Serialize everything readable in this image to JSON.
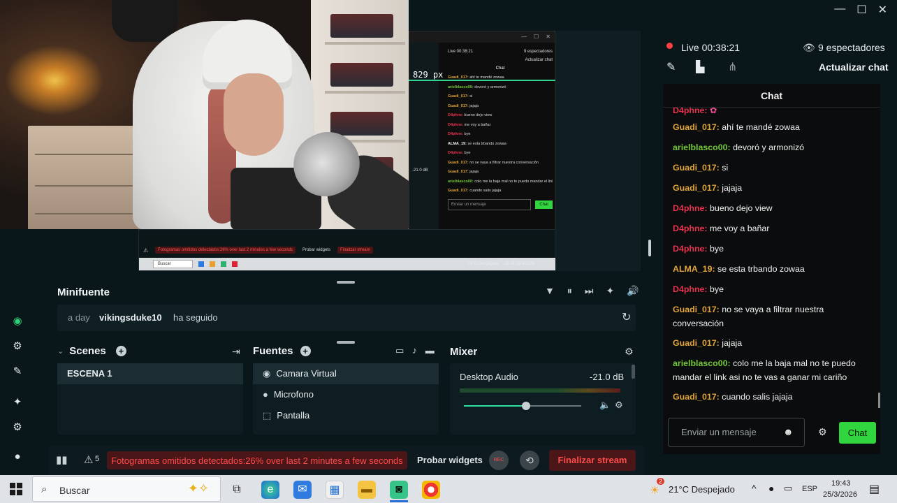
{
  "window": {
    "min": "—",
    "max": "☐",
    "close": "✕",
    "collapse": "›"
  },
  "preview": {
    "pixel_label": "829 px",
    "title_controls": [
      "—",
      "☐",
      "✕"
    ],
    "live": "Live 00:38:21",
    "viewers": "9 espectadores",
    "update": "Actualizar chat",
    "chat_heading": "Chat",
    "messages": [
      {
        "user": "Guadi_017:",
        "text": "ahí te mandé zowaa",
        "color": "#e0a43a"
      },
      {
        "user": "arielblasco00:",
        "text": "devoró y armonizó",
        "color": "#74c93a"
      },
      {
        "user": "Guadi_017:",
        "text": "si",
        "color": "#e0a43a"
      },
      {
        "user": "Guadi_017:",
        "text": "jajaja",
        "color": "#e0a43a"
      },
      {
        "user": "D4phne:",
        "text": "bueno dejo view",
        "color": "#e8334f"
      },
      {
        "user": "D4phne:",
        "text": "me voy a bañar",
        "color": "#e8334f"
      },
      {
        "user": "D4phne:",
        "text": "bye",
        "color": "#e8334f"
      },
      {
        "user": "ALMA_19:",
        "text": "se esta trbando zowaa",
        "color": "#f0f0f0"
      },
      {
        "user": "D4phne:",
        "text": "bye",
        "color": "#e8334f"
      },
      {
        "user": "Guadi_017:",
        "text": "no se vaya a filtrar nuestra conversación",
        "color": "#e0a43a"
      },
      {
        "user": "Guadi_017:",
        "text": "jajaja",
        "color": "#e0a43a"
      },
      {
        "user": "arielblasco00:",
        "text": "colo me la baja mal no te puedo mandar el link asi no te vas a ganar mi cariño",
        "color": "#74c93a"
      },
      {
        "user": "Guadi_017:",
        "text": "cuando salis jajaja",
        "color": "#e0a43a"
      }
    ],
    "input_placeholder": "Enviar un mensaje",
    "chat_button": "Chat",
    "db": "-21.0 dB",
    "temp": "21°C Despejado",
    "time": "19:43",
    "date": "25/3/2026",
    "search": "Buscar",
    "dropped": "Fotogramas omitidos detectados:26% over last 2 minutes a few seconds",
    "probar": "Probar widgets",
    "finalizar": "Finalizar stream"
  },
  "minifuente": {
    "title": "Minifuente",
    "event_time": "a day",
    "event_user": "vikingsduke10",
    "event_action": "ha seguido",
    "controls": [
      "▼",
      "⏸",
      "⏭",
      "✦",
      "🔊"
    ]
  },
  "scenes": {
    "title": "Scenes",
    "items": [
      "ESCENA 1"
    ]
  },
  "sources": {
    "title": "Fuentes",
    "items": [
      {
        "label": "Camara Virtual",
        "icon": "webcam-icon"
      },
      {
        "label": "Microfono",
        "icon": "microphone-icon"
      },
      {
        "label": "Pantalla",
        "icon": "screen-icon"
      }
    ]
  },
  "mixer": {
    "title": "Mixer",
    "channel": "Desktop Audio",
    "db": "-21.0 dB",
    "volume_fraction": 0.53
  },
  "footer": {
    "alerts": "5",
    "dropped": "Fotogramas omitidos detectados:26% over last 2 minutes a few seconds",
    "probar": "Probar widgets",
    "rec": "REC",
    "finalizar": "Finalizar stream"
  },
  "chatpanel": {
    "live": "Live 00:38:21",
    "viewers": "9 espectadores",
    "update": "Actualizar chat",
    "heading": "Chat",
    "messages": [
      {
        "user": "D4phne:",
        "text": "",
        "color": "#e8334f"
      },
      {
        "user": "Guadi_017:",
        "text": "ahí te mandé zowaa",
        "color": "#e0a43a"
      },
      {
        "user": "arielblasco00:",
        "text": "devoró y armonizó",
        "color": "#74c93a"
      },
      {
        "user": "Guadi_017:",
        "text": "si",
        "color": "#e0a43a"
      },
      {
        "user": "Guadi_017:",
        "text": "jajaja",
        "color": "#e0a43a"
      },
      {
        "user": "D4phne:",
        "text": "bueno dejo view",
        "color": "#e8334f"
      },
      {
        "user": "D4phne:",
        "text": "me voy a bañar",
        "color": "#e8334f"
      },
      {
        "user": "D4phne:",
        "text": "bye",
        "color": "#e8334f"
      },
      {
        "user": "ALMA_19:",
        "text": "se esta trbando zowaa",
        "color": "#e0a43a"
      },
      {
        "user": "D4phne:",
        "text": "bye",
        "color": "#e8334f"
      },
      {
        "user": "Guadi_017:",
        "text": "no se vaya a filtrar nuestra conversación",
        "color": "#e0a43a"
      },
      {
        "user": "Guadi_017:",
        "text": "jajaja",
        "color": "#e0a43a"
      },
      {
        "user": "arielblasco00:",
        "text": "colo me la baja mal no te puedo mandar el link asi no te vas a ganar mi cariño",
        "color": "#74c93a"
      },
      {
        "user": "Guadi_017:",
        "text": "cuando salis jajaja",
        "color": "#e0a43a"
      }
    ],
    "input_placeholder": "Enviar un mensaje",
    "chat_button": "Chat"
  },
  "taskbar": {
    "search_placeholder": "Buscar",
    "weather_badge": "2",
    "weather": "21°C  Despejado",
    "lang": "ESP",
    "time": "19:43",
    "date": "25/3/2026"
  },
  "colors": {
    "accent": "#31d53d",
    "danger": "#ff4d4d",
    "bg": "#09161a"
  }
}
